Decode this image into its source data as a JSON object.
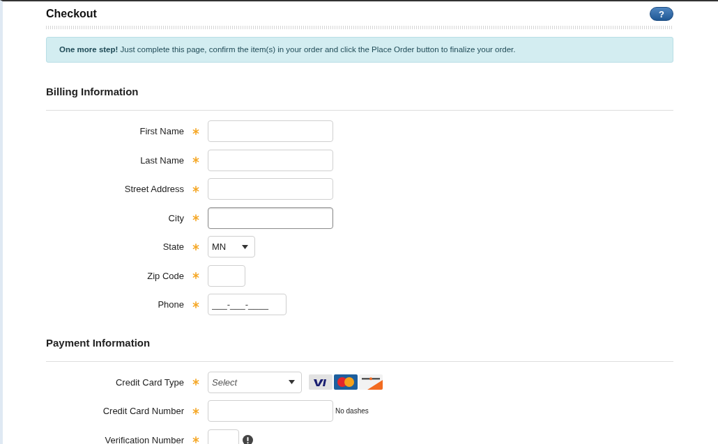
{
  "page": {
    "title": "Checkout",
    "help_button": "?"
  },
  "notice": "**One more step!** Just complete this page, confirm the item(s) in your order and click the Place Order button to finalize your order.",
  "sections": [
    {
      "heading": "Billing Information",
      "fields": [
        {
          "kind": "text",
          "label": "First Name",
          "required": true
        },
        {
          "kind": "text",
          "label": "Last Name",
          "required": true
        },
        {
          "kind": "text",
          "label": "Street Address",
          "required": true
        },
        {
          "kind": "text",
          "label": "City",
          "required": true,
          "focused": true
        },
        {
          "kind": "select",
          "label": "State",
          "required": true,
          "value": "MN"
        },
        {
          "kind": "text",
          "label": "Zip Code",
          "required": true
        },
        {
          "kind": "text",
          "label": "Phone",
          "required": true,
          "placeholder": "___-___-____"
        }
      ]
    },
    {
      "heading": "Payment Information",
      "fields": [
        {
          "kind": "select",
          "label": "Credit Card Type",
          "required": true,
          "placeholder": "Select",
          "card_logos": true
        },
        {
          "kind": "text",
          "label": "Credit Card Number",
          "required": true,
          "hint": "No dashes"
        },
        {
          "kind": "text",
          "label": "Verification Number",
          "required": true,
          "info": true
        }
      ]
    }
  ]
}
